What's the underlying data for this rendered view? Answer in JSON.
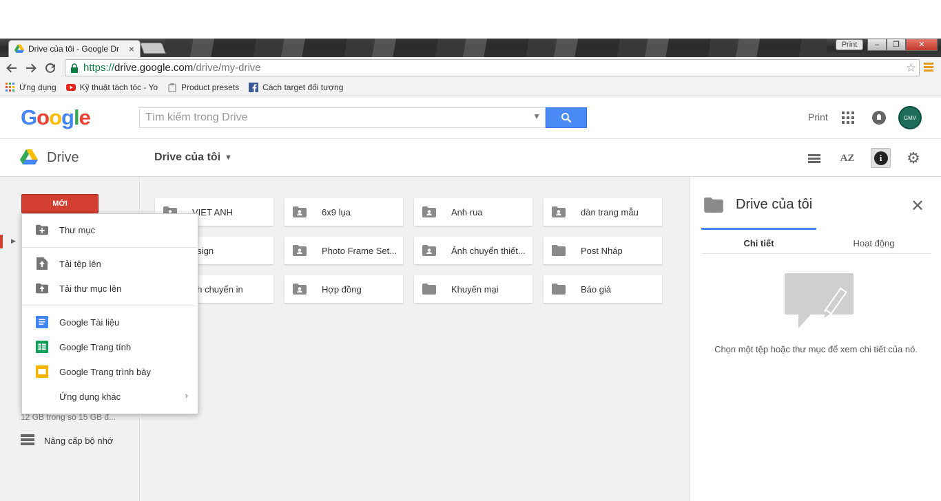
{
  "browser": {
    "tab_title": "Drive của tôi - Google Dr",
    "tab_close": "×",
    "print_btn": "Print",
    "url_scheme": "https://",
    "url_host": "drive.google.com",
    "url_path": "/drive/my-drive",
    "bookmarks": [
      {
        "label": "Ứng dụng"
      },
      {
        "label": "Kỹ thuật tách tóc - Yo"
      },
      {
        "label": "Product presets"
      },
      {
        "label": "Cách target đối tượng"
      }
    ]
  },
  "header": {
    "search_placeholder": "Tìm kiếm trong Drive",
    "print_link": "Print",
    "avatar_text": "GMV"
  },
  "subheader": {
    "drive_label": "Drive",
    "breadcrumb": "Drive của tôi",
    "az_label": "AZ",
    "info_label": "i"
  },
  "sidebar": {
    "new_button": "MỚI",
    "storage": "12 GB trong số 15 GB đ...",
    "upgrade": "Nâng cấp bộ nhớ"
  },
  "folders": [
    {
      "name": "VIET ANH",
      "type": "shared"
    },
    {
      "name": "6x9 lụa",
      "type": "shared"
    },
    {
      "name": "Anh rua",
      "type": "shared"
    },
    {
      "name": "dàn trang mẫu",
      "type": "shared"
    },
    {
      "name": "esign",
      "type": "shared"
    },
    {
      "name": "Photo Frame Set...",
      "type": "shared"
    },
    {
      "name": "Ảnh chuyển thiết...",
      "type": "shared"
    },
    {
      "name": "Post Nháp",
      "type": "folder"
    },
    {
      "name": "nh chuyển in",
      "type": "shared"
    },
    {
      "name": "Hợp đồng",
      "type": "shared"
    },
    {
      "name": "Khuyến mại",
      "type": "folder"
    },
    {
      "name": "Báo giá",
      "type": "folder"
    }
  ],
  "new_menu": {
    "items": [
      {
        "label": "Thư mục",
        "icon": "folder-plus-icon"
      },
      {
        "label": "Tải tệp lên",
        "icon": "file-upload-icon"
      },
      {
        "label": "Tải thư mục lên",
        "icon": "folder-upload-icon"
      },
      {
        "label": "Google Tài liệu",
        "icon": "docs-icon"
      },
      {
        "label": "Google Trang tính",
        "icon": "sheets-icon"
      },
      {
        "label": "Google Trang trình bày",
        "icon": "slides-icon"
      },
      {
        "label": "Ứng dụng khác",
        "icon": "none"
      }
    ],
    "submenu_arrow": "›"
  },
  "details": {
    "title": "Drive của tôi",
    "tabs": [
      "Chi tiết",
      "Hoạt động"
    ],
    "message": "Chọn một tệp hoặc thư mục để xem chi tiết của nó."
  },
  "colors": {
    "new_button": "#d23f31",
    "search_button": "#4a8af4",
    "tab_indicator": "#4285f4",
    "url_green": "#0b8043"
  }
}
